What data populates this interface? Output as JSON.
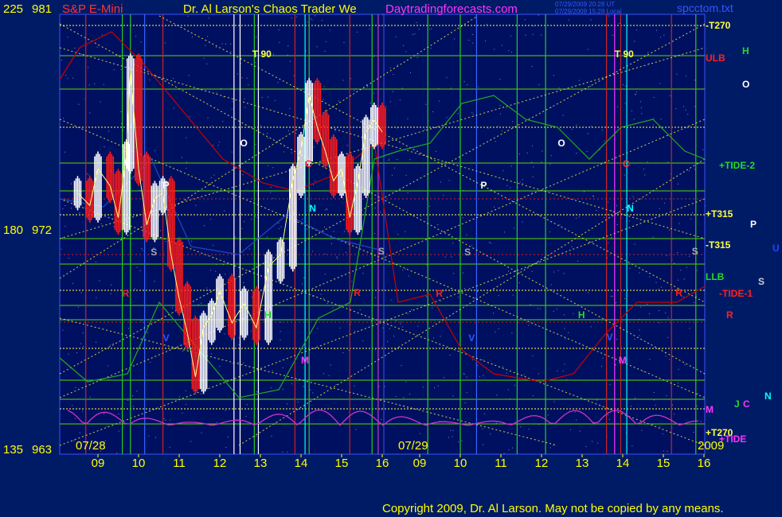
{
  "header": {
    "instrument": "S&P E-Mini",
    "title_main": "Dr. Al Larson's Chaos Trader We",
    "title_site": "Daytradingforecasts.com",
    "stamp1": "07/29/2009 20:28 UT",
    "stamp2": "07/29/2009 15:28 Local",
    "filename": "spcctom.txt"
  },
  "copyright": "Copyright 2009, Dr. Al Larson. May not be copied by any means.",
  "colors": {
    "background": "#001b66",
    "plot_area": "#001060",
    "price_up": "#ffffff",
    "price_down": "#ff1a1a",
    "grid_yellow": "#ffff40",
    "grid_green": "#55dd00",
    "tide_red": "#cc0000",
    "tide_green": "#22aa22",
    "oscillator": "#cc33cc",
    "axis_text": "#ffff00",
    "copyright_text": "#ffff00"
  },
  "chart_data": {
    "type": "line",
    "title": "S&P E-Mini",
    "series_kind": "price bars with astro/field lines",
    "y_axis_left": {
      "angle_ticks": [
        "225",
        "180",
        "135"
      ],
      "price_ticks": [
        "981",
        "972",
        "963"
      ],
      "ylim": [
        963,
        981
      ]
    },
    "x_axis": {
      "hour_labels": [
        "09",
        "10",
        "11",
        "12",
        "13",
        "14",
        "15",
        "16",
        "09",
        "10",
        "11",
        "12",
        "13",
        "14",
        "15",
        "16"
      ],
      "day_labels": [
        "07/28",
        "07/29"
      ],
      "year_label": "2009"
    },
    "price_series_0728": {
      "name": "S&P E-Mini 07/28",
      "x_hours": [
        8.5,
        8.8,
        9.0,
        9.3,
        9.5,
        9.7,
        9.8,
        10.0,
        10.2,
        10.4,
        10.6,
        10.8,
        11.0,
        11.2,
        11.4,
        11.6,
        11.8,
        12.0,
        12.3,
        12.6,
        12.9,
        13.2,
        13.5,
        13.8,
        14.0,
        14.2,
        14.4,
        14.6,
        14.8,
        15.0,
        15.2,
        15.4,
        15.6,
        15.8,
        16.0
      ],
      "values": [
        973.5,
        973.0,
        974.5,
        973.8,
        972.5,
        975.0,
        978.5,
        974.5,
        972.2,
        973.3,
        973.5,
        971.0,
        969.2,
        967.8,
        966.0,
        968.0,
        968.5,
        969.5,
        968.2,
        969.0,
        968.0,
        970.5,
        971.0,
        974.0,
        975.3,
        977.5,
        976.2,
        975.2,
        974.0,
        974.5,
        972.5,
        974.0,
        976.0,
        976.5,
        976.0
      ]
    },
    "markers": {
      "left_panel": [
        {
          "label": "T  90",
          "x": 12.8
        },
        {
          "label": "O",
          "x": 12.5
        },
        {
          "label": "P",
          "x": 10.6
        },
        {
          "label": "N",
          "x": 14.2
        },
        {
          "label": "C",
          "x": 14.1
        },
        {
          "label": "S",
          "x": 10.3
        },
        {
          "label": "S",
          "x": 15.9
        },
        {
          "label": "R",
          "x": 9.6
        },
        {
          "label": "R",
          "x": 15.3
        },
        {
          "label": "M",
          "x": 14.0
        },
        {
          "label": "H",
          "x": 13.1
        },
        {
          "label": "V",
          "x": 10.6
        }
      ],
      "right_panel": [
        {
          "label": "T  90",
          "x": 13.8
        },
        {
          "label": "O",
          "x": 12.4
        },
        {
          "label": "P",
          "x": 10.5
        },
        {
          "label": "N",
          "x": 14.1
        },
        {
          "label": "C",
          "x": 14.0
        },
        {
          "label": "S",
          "x": 10.1
        },
        {
          "label": "S",
          "x": 15.7
        },
        {
          "label": "R",
          "x": 9.4
        },
        {
          "label": "R",
          "x": 15.3
        },
        {
          "label": "M",
          "x": 13.9
        },
        {
          "label": "H",
          "x": 12.9
        },
        {
          "label": "V",
          "x": 10.2
        },
        {
          "label": "V",
          "x": 13.6
        }
      ]
    },
    "right_labels": [
      {
        "text": "-T270",
        "color": "#ffff40"
      },
      {
        "text": "H",
        "color": "#22dd22"
      },
      {
        "text": "ULB",
        "color": "#ff2020"
      },
      {
        "text": "O",
        "color": "#ffffff"
      },
      {
        "text": "+TIDE-2",
        "color": "#22dd22"
      },
      {
        "text": "+T315",
        "color": "#ffff40"
      },
      {
        "text": "P",
        "color": "#ffffff"
      },
      {
        "text": "-T315",
        "color": "#ffff40"
      },
      {
        "text": "U",
        "color": "#2244ff"
      },
      {
        "text": "LLB",
        "color": "#22dd22"
      },
      {
        "text": "S",
        "color": "#cccccc"
      },
      {
        "text": "-TIDE-1",
        "color": "#ff2020"
      },
      {
        "text": "R",
        "color": "#ff2020"
      },
      {
        "text": "N",
        "color": "#00ffff"
      },
      {
        "text": "M",
        "color": "#ff33ff"
      },
      {
        "text": "J",
        "color": "#22dd22"
      },
      {
        "text": "C",
        "color": "#ff33ff"
      },
      {
        "text": "+T270",
        "color": "#ffff40"
      },
      {
        "text": "+TIDE",
        "color": "#ff33ff"
      }
    ]
  }
}
